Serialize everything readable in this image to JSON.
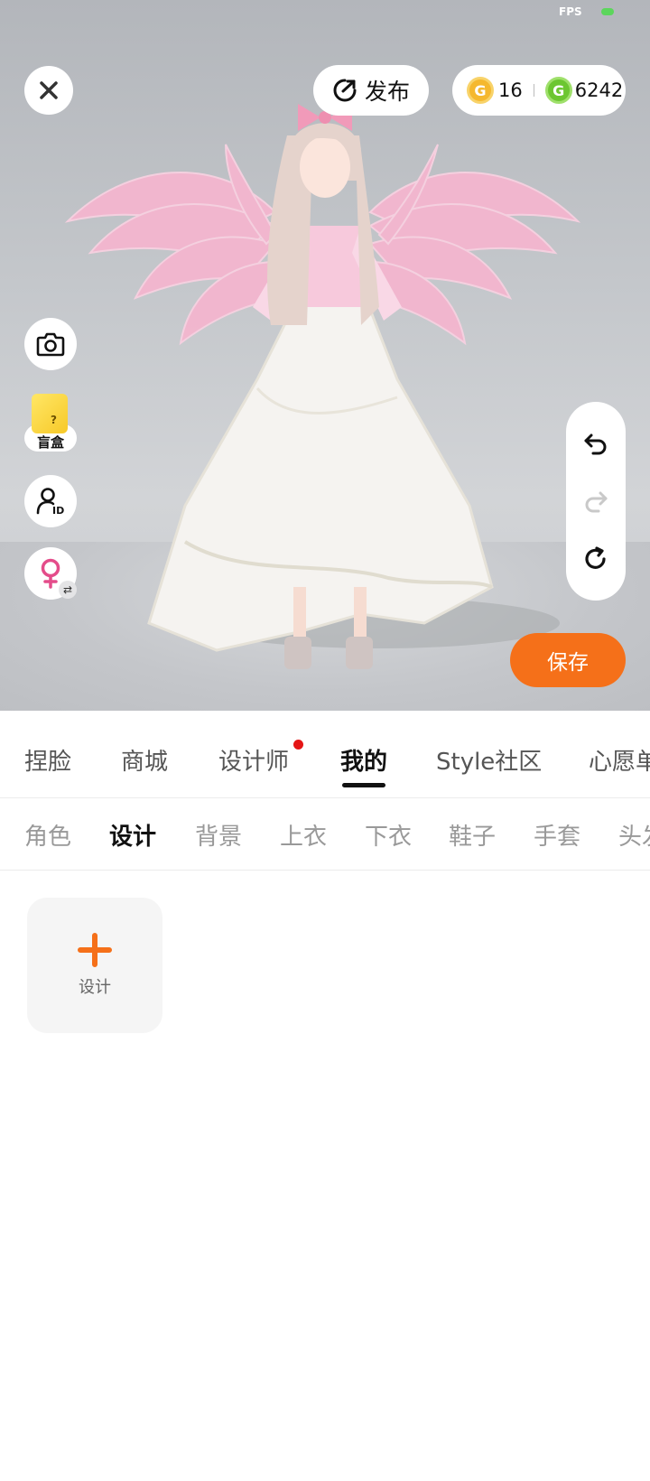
{
  "status": {
    "fps_label": "FPS"
  },
  "toolbar": {
    "publish_label": "发布",
    "gold_coins": "16",
    "green_coins": "6242"
  },
  "side": {
    "blindbox_label": "盲盒"
  },
  "save_label": "保存",
  "main_tabs": [
    "捏脸",
    "商城",
    "设计师",
    "我的",
    "Style社区",
    "心愿单"
  ],
  "main_tab_active": "我的",
  "sub_tabs": [
    "角色",
    "设计",
    "背景",
    "上衣",
    "下衣",
    "鞋子",
    "手套",
    "头发"
  ],
  "sub_tab_active": "设计",
  "design_card": {
    "label": "设计"
  },
  "colors": {
    "accent": "#f57019",
    "badge": "#e51616",
    "gold": "#f5b82e",
    "green": "#6cc631"
  },
  "icons": [
    "close-icon",
    "publish-icon",
    "gold-coin-icon",
    "green-coin-icon",
    "camera-icon",
    "blindbox-icon",
    "id-card-icon",
    "female-gender-icon",
    "swap-icon",
    "undo-icon",
    "redo-icon",
    "reset-icon",
    "plus-icon"
  ]
}
